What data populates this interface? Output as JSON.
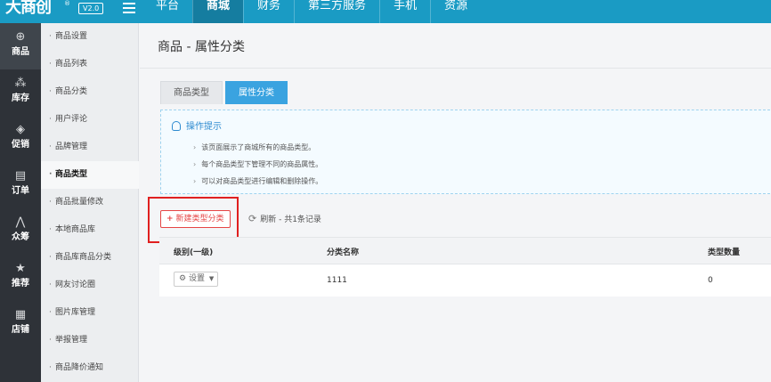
{
  "header": {
    "logo": "大商创",
    "logo_reg": "®",
    "version": "V2.0",
    "nav": [
      "平台",
      "商城",
      "财务",
      "第三方服务",
      "手机",
      "资源"
    ],
    "active_nav": "商城"
  },
  "iconbar": [
    {
      "label": "商品",
      "icon": "bag-icon",
      "glyph": "⊕"
    },
    {
      "label": "库存",
      "icon": "boxes-icon",
      "glyph": "⁂"
    },
    {
      "label": "促销",
      "icon": "tag-icon",
      "glyph": "◈"
    },
    {
      "label": "订单",
      "icon": "document-icon",
      "glyph": "▤"
    },
    {
      "label": "众筹",
      "icon": "crowdfund-icon",
      "glyph": "⋀"
    },
    {
      "label": "推荐",
      "icon": "star-icon",
      "glyph": "★"
    },
    {
      "label": "店铺",
      "icon": "store-icon",
      "glyph": "▦"
    }
  ],
  "subnav": [
    "商品设置",
    "商品列表",
    "商品分类",
    "用户评论",
    "品牌管理",
    "商品类型",
    "商品批量修改",
    "本地商品库",
    "商品库商品分类",
    "网友讨论圈",
    "图片库管理",
    "举报管理",
    "商品降价通知"
  ],
  "main": {
    "title": "商品 - 属性分类",
    "tabs": [
      "商品类型",
      "属性分类"
    ],
    "tips": {
      "heading": "操作提示",
      "items": [
        "该页面展示了商城所有的商品类型。",
        "每个商品类型下管理不同的商品属性。",
        "可以对商品类型进行编辑和删除操作。"
      ]
    },
    "add_button": "新建类型分类",
    "refresh": "刷新 - 共1条记录",
    "table": {
      "headers": [
        "级别(一级)",
        "分类名称",
        "类型数量"
      ],
      "rows": [
        {
          "action": "设置",
          "name": "1111",
          "count": "0"
        }
      ]
    }
  },
  "colors": {
    "topbar": "#1a9bc4",
    "accent": "#3aa3e0",
    "danger": "#e64545"
  }
}
